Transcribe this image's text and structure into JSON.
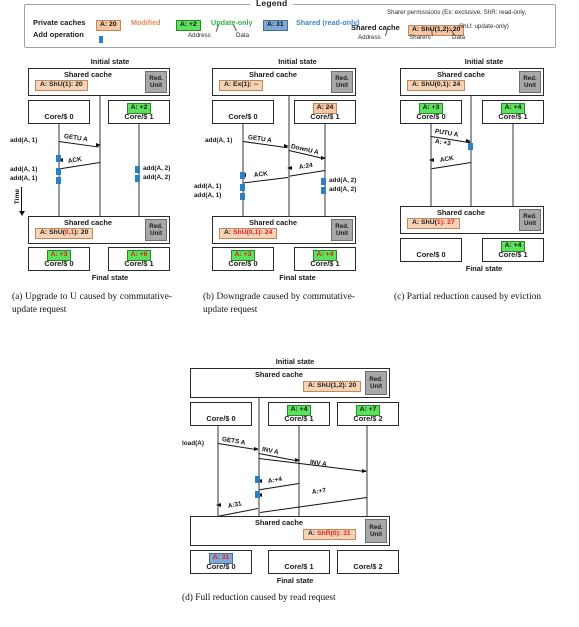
{
  "legend": {
    "title": "Legend",
    "row1_label": "Private caches",
    "row2_label": "Add operation",
    "shared_cache_label": "Shared cache",
    "chip_modified": "A: 20",
    "text_modified": "Modified",
    "chip_update": "A: +2",
    "text_update": "Update-only",
    "chip_shared": "A: 31",
    "text_shared": "Shared (read-only)",
    "chip_shared_cache": "A: ShU(1,2): 20",
    "ann_address": "Address",
    "ann_data": "Data",
    "ann_address2": "Address",
    "ann_sharers": "Sharers",
    "ann_data2": "Data",
    "sharer_perm_line1": "Sharer permissions (Ex: exclusive, ShR: read-only,",
    "sharer_perm_line2": "ShU: update-only)"
  },
  "common": {
    "initial_state": "Initial state",
    "final_state": "Final state",
    "shared_cache": "Shared cache",
    "red_unit_line1": "Red.",
    "red_unit_line2": "Unit",
    "time_label": "Time"
  },
  "panels": [
    {
      "id": "a",
      "caption": "(a) Upgrade to U caused by commutative-update request",
      "initial": {
        "cache_entry": "A: ShU(1): 20",
        "cores": [
          {
            "name": "Core/$ 0",
            "chip": null,
            "chip_type": null
          },
          {
            "name": "Core/$ 1",
            "chip": "A: +2",
            "chip_type": "update"
          }
        ]
      },
      "messages": [
        {
          "label": "GETU A",
          "dir": "right"
        },
        {
          "label": "ACK",
          "dir": "left"
        }
      ],
      "ops": [
        {
          "label": "add(A, 1)",
          "side": "left"
        },
        {
          "label": "add(A, 1)",
          "side": "left"
        },
        {
          "label": "add(A, 1)",
          "side": "left"
        },
        {
          "label": "add(A, 2)",
          "side": "right"
        },
        {
          "label": "add(A, 2)",
          "side": "right"
        }
      ],
      "final": {
        "cache_entry_pre": "A: ShU(",
        "cache_entry_hl": "0,1",
        "cache_entry_post": "): 20",
        "cores": [
          {
            "name": "Core/$ 0",
            "chip": "A: +3",
            "chip_type": "update",
            "chip_red": true
          },
          {
            "name": "Core/$ 1",
            "chip": "A: +6",
            "chip_type": "update",
            "chip_red": true
          }
        ]
      }
    },
    {
      "id": "b",
      "caption": "(b) Downgrade caused by commutative-update request",
      "initial": {
        "cache_entry": "A: Ex(1): --",
        "cores": [
          {
            "name": "Core/$ 0",
            "chip": null,
            "chip_type": null
          },
          {
            "name": "Core/$ 1",
            "chip": "A: 24",
            "chip_type": "modified"
          }
        ]
      },
      "messages": [
        {
          "label": "GETU A",
          "dir": "right"
        },
        {
          "label": "DownU A",
          "dir": "right"
        },
        {
          "label": "A:24",
          "dir": "left"
        },
        {
          "label": "ACK",
          "dir": "left"
        }
      ],
      "ops": [
        {
          "label": "add(A, 1)",
          "side": "left"
        },
        {
          "label": "add(A, 1)",
          "side": "left"
        },
        {
          "label": "add(A, 1)",
          "side": "left"
        },
        {
          "label": "add(A, 2)",
          "side": "right"
        },
        {
          "label": "add(A, 2)",
          "side": "right"
        }
      ],
      "final": {
        "cache_entry_pre": "A: ",
        "cache_entry_hl": "ShU(0,1): 24",
        "cache_entry_post": "",
        "cores": [
          {
            "name": "Core/$ 0",
            "chip": "A: +3",
            "chip_type": "update",
            "chip_red": true
          },
          {
            "name": "Core/$ 1",
            "chip": "A: +4",
            "chip_type": "update",
            "chip_red": true
          }
        ]
      }
    },
    {
      "id": "c",
      "caption": "(c) Partial reduction caused by eviction",
      "initial": {
        "cache_entry": "A: ShU(0,1): 24",
        "cores": [
          {
            "name": "Core/$ 0",
            "chip": "A: +3",
            "chip_type": "update"
          },
          {
            "name": "Core/$ 1",
            "chip": "A: +4",
            "chip_type": "update"
          }
        ]
      },
      "messages": [
        {
          "label": "PUTU A",
          "dir": "right"
        },
        {
          "label": "A: +3",
          "dir": "right"
        },
        {
          "label": "ACK",
          "dir": "left"
        }
      ],
      "ops": [],
      "final": {
        "cache_entry_pre": "A: ShU(",
        "cache_entry_hl": "1",
        "cache_entry_post": "): 27",
        "cores": [
          {
            "name": "Core/$ 0",
            "chip": null,
            "chip_type": null
          },
          {
            "name": "Core/$ 1",
            "chip": "A: +4",
            "chip_type": "update"
          }
        ]
      }
    },
    {
      "id": "d",
      "caption": "(d) Full reduction caused by read request",
      "initial": {
        "cache_entry": "A: ShU(1,2): 20",
        "cores": [
          {
            "name": "Core/$ 0",
            "chip": null,
            "chip_type": null
          },
          {
            "name": "Core/$ 1",
            "chip": "A: +4",
            "chip_type": "update"
          },
          {
            "name": "Core/$ 2",
            "chip": "A: +7",
            "chip_type": "update"
          }
        ]
      },
      "messages": [
        {
          "label": "GETS A",
          "dir": "right"
        },
        {
          "label": "INV A",
          "dir": "right"
        },
        {
          "label": "INV A",
          "dir": "right"
        },
        {
          "label": "A:+4",
          "dir": "left"
        },
        {
          "label": "A:+7",
          "dir": "left"
        },
        {
          "label": "A:31",
          "dir": "left"
        }
      ],
      "ops": [
        {
          "label": "load(A)",
          "side": "left"
        }
      ],
      "final": {
        "cache_entry_pre": "A: ",
        "cache_entry_hl": "ShR(0): 31",
        "cache_entry_post": "",
        "cores": [
          {
            "name": "Core/$ 0",
            "chip": "A: 31",
            "chip_type": "shared",
            "chip_red": true
          },
          {
            "name": "Core/$ 1",
            "chip": null,
            "chip_type": null
          },
          {
            "name": "Core/$ 2",
            "chip": null,
            "chip_type": null
          }
        ]
      }
    }
  ]
}
